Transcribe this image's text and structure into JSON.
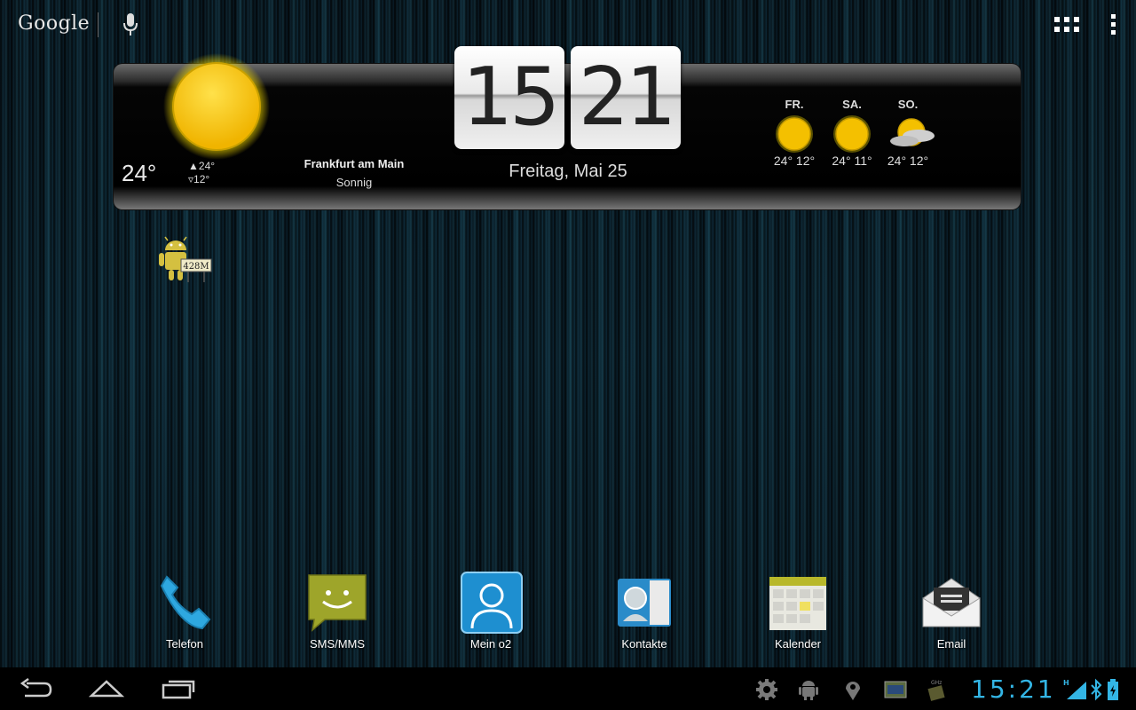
{
  "top_bar": {
    "search_logo": "Google",
    "icons": [
      "mic-icon",
      "apps-grid-icon",
      "overflow-menu-icon"
    ]
  },
  "weather_widget": {
    "current_temp": "24°",
    "high": "24°",
    "low": "12°",
    "high_arrow": "▲",
    "low_arrow": "▿",
    "location": "Frankfurt am Main",
    "condition": "Sonnig",
    "clock_hours": "15",
    "clock_minutes": "21",
    "date": "Freitag, Mai 25",
    "forecast": [
      {
        "day": "FR.",
        "temps": "24° 12°",
        "icon": "sun-icon"
      },
      {
        "day": "SA.",
        "temps": "24° 11°",
        "icon": "sun-icon"
      },
      {
        "day": "SO.",
        "temps": "24° 12°",
        "icon": "partly-cloudy-icon"
      }
    ]
  },
  "memory_widget": {
    "value": "428M"
  },
  "dock": [
    {
      "label": "Telefon",
      "icon": "phone-icon"
    },
    {
      "label": "SMS/MMS",
      "icon": "sms-icon"
    },
    {
      "label": "Mein o2",
      "icon": "person-icon"
    },
    {
      "label": "Kontakte",
      "icon": "contacts-icon"
    },
    {
      "label": "Kalender",
      "icon": "calendar-icon"
    },
    {
      "label": "Email",
      "icon": "email-icon"
    }
  ],
  "nav_bar": {
    "status_time": "15:21",
    "icons": [
      "back-icon",
      "home-icon",
      "recent-apps-icon",
      "settings-gear-icon",
      "android-icon",
      "location-icon",
      "gallery-icon",
      "cpu-icon",
      "signal-icon",
      "bluetooth-icon",
      "battery-icon"
    ]
  },
  "colors": {
    "accent": "#33b5e5",
    "sun": "#f5c400",
    "sms_bg": "#9ea52a",
    "o2_bg": "#1e8fd0"
  }
}
